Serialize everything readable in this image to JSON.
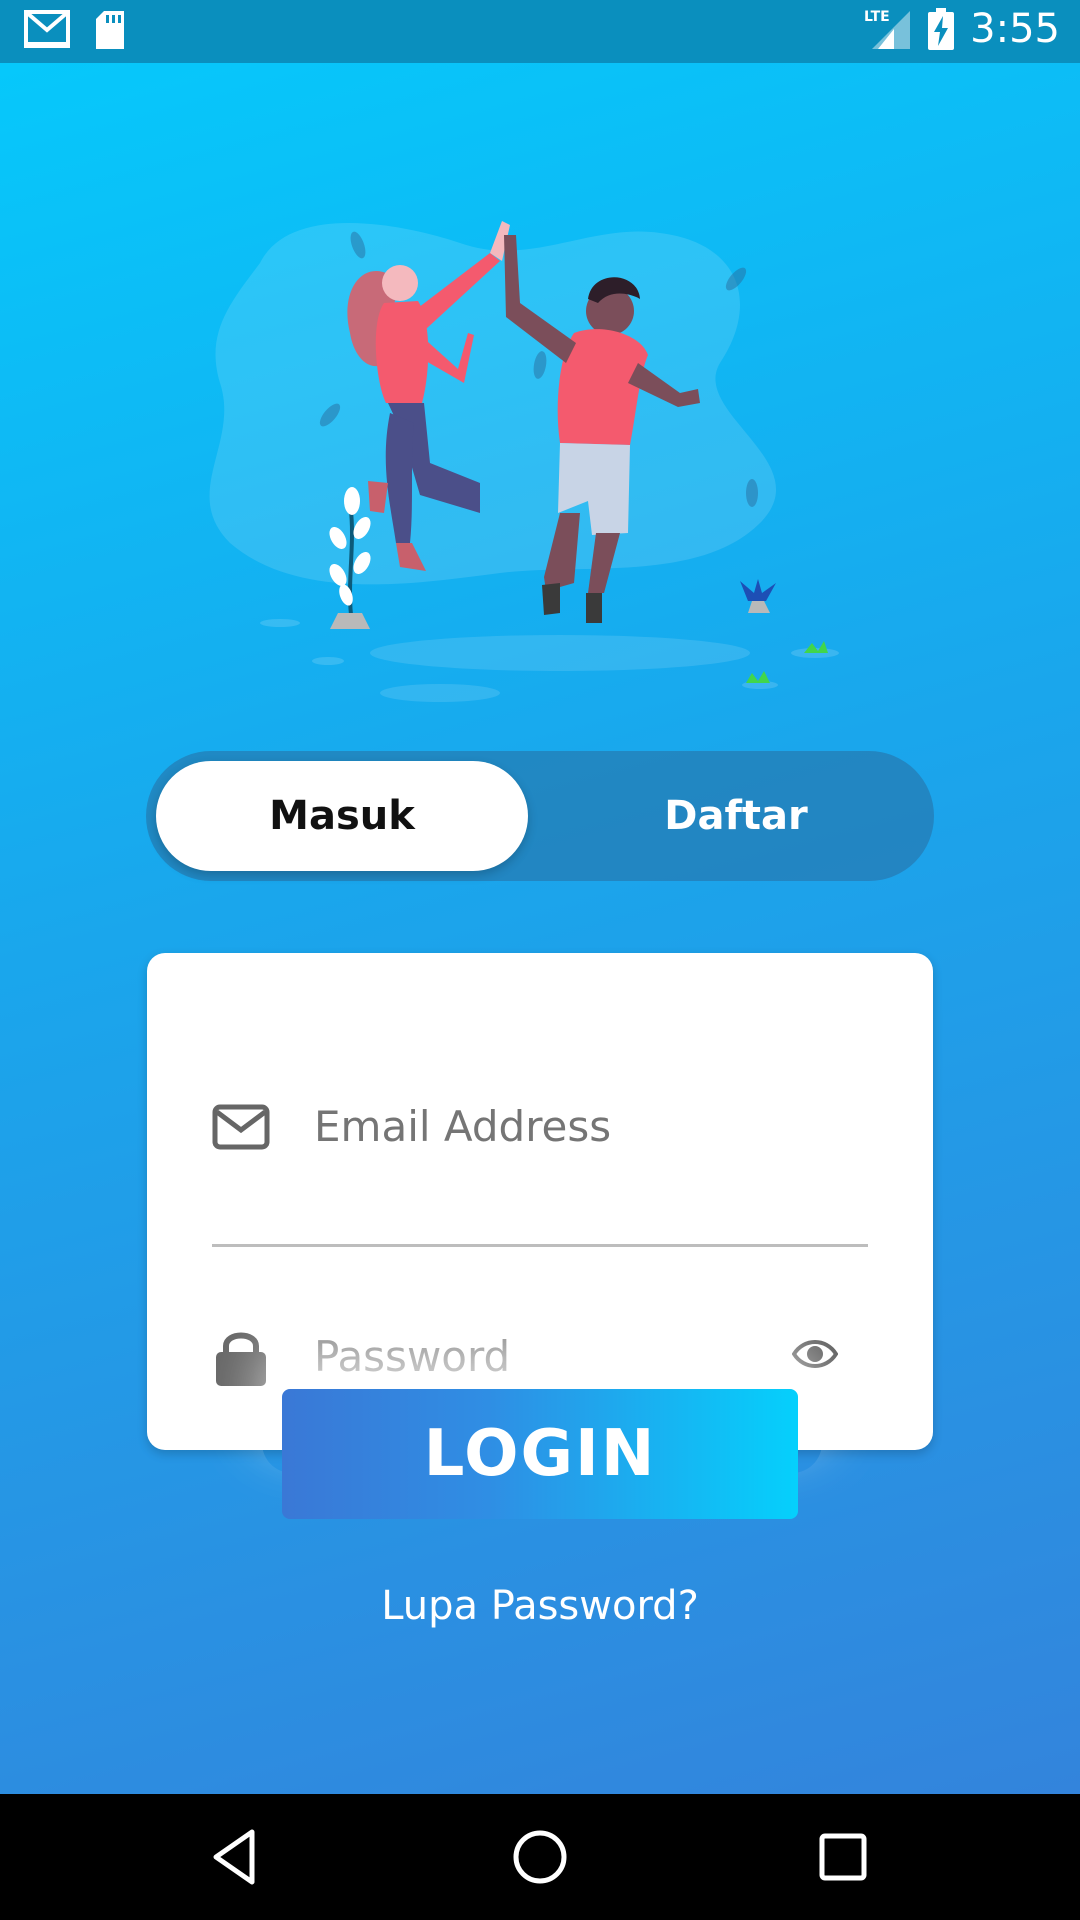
{
  "status_bar": {
    "time": "3:55",
    "network": "LTE",
    "icons": [
      "gmail-icon",
      "sd-card-icon",
      "signal-icon",
      "battery-charging-icon"
    ]
  },
  "toggle": {
    "masuk_label": "Masuk",
    "daftar_label": "Daftar",
    "active": "Masuk"
  },
  "form": {
    "email_placeholder": "Email Address",
    "password_placeholder": "Password",
    "email_icon": "envelope-icon",
    "password_icon": "lock-icon",
    "visibility_icon": "eye-icon"
  },
  "login_label": "LOGIN",
  "forgot_label": "Lupa Password?",
  "nav": [
    "back-icon",
    "home-icon",
    "recents-icon"
  ],
  "colors": {
    "gradient_top": "#06c8fb",
    "gradient_bottom": "#3384dc",
    "status_bar": "#0a8fbe",
    "button_start": "#3a78d6",
    "button_end": "#05d0fc"
  }
}
